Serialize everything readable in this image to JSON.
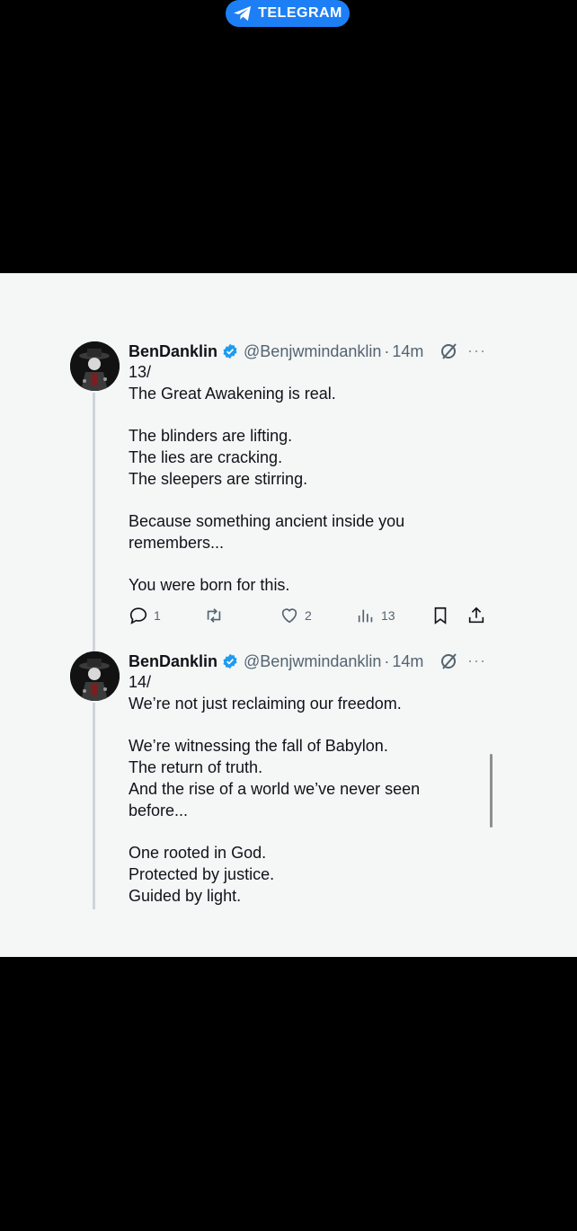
{
  "header": {
    "badge_label": "TELEGRAM"
  },
  "tweets": [
    {
      "name": "BenDanklin",
      "handle": "@Benjwmindanklin",
      "dot": "·",
      "time": "14m",
      "more": "···",
      "lines": [
        "13/",
        "The Great Awakening is real.",
        "",
        "The blinders are lifting.",
        "The lies are cracking.",
        "The sleepers are stirring.",
        "",
        "Because something ancient inside you",
        "remembers...",
        "",
        "You were born for this."
      ],
      "replies": "1",
      "likes": "2",
      "views": "13"
    },
    {
      "name": "BenDanklin",
      "handle": "@Benjwmindanklin",
      "dot": "·",
      "time": "14m",
      "more": "···",
      "lines": [
        "14/",
        "We’re not just reclaiming our freedom.",
        "",
        "We’re witnessing the fall of Babylon.",
        "The return of truth.",
        "And the rise of a world we’ve never seen",
        "before...",
        "",
        "One rooted in God.",
        "Protected by justice.",
        "Guided by light."
      ]
    }
  ],
  "colors": {
    "accent": "#1d9bf0",
    "telegram_blue": "#1d7ff5",
    "text": "#0f1419",
    "muted": "#536471"
  }
}
